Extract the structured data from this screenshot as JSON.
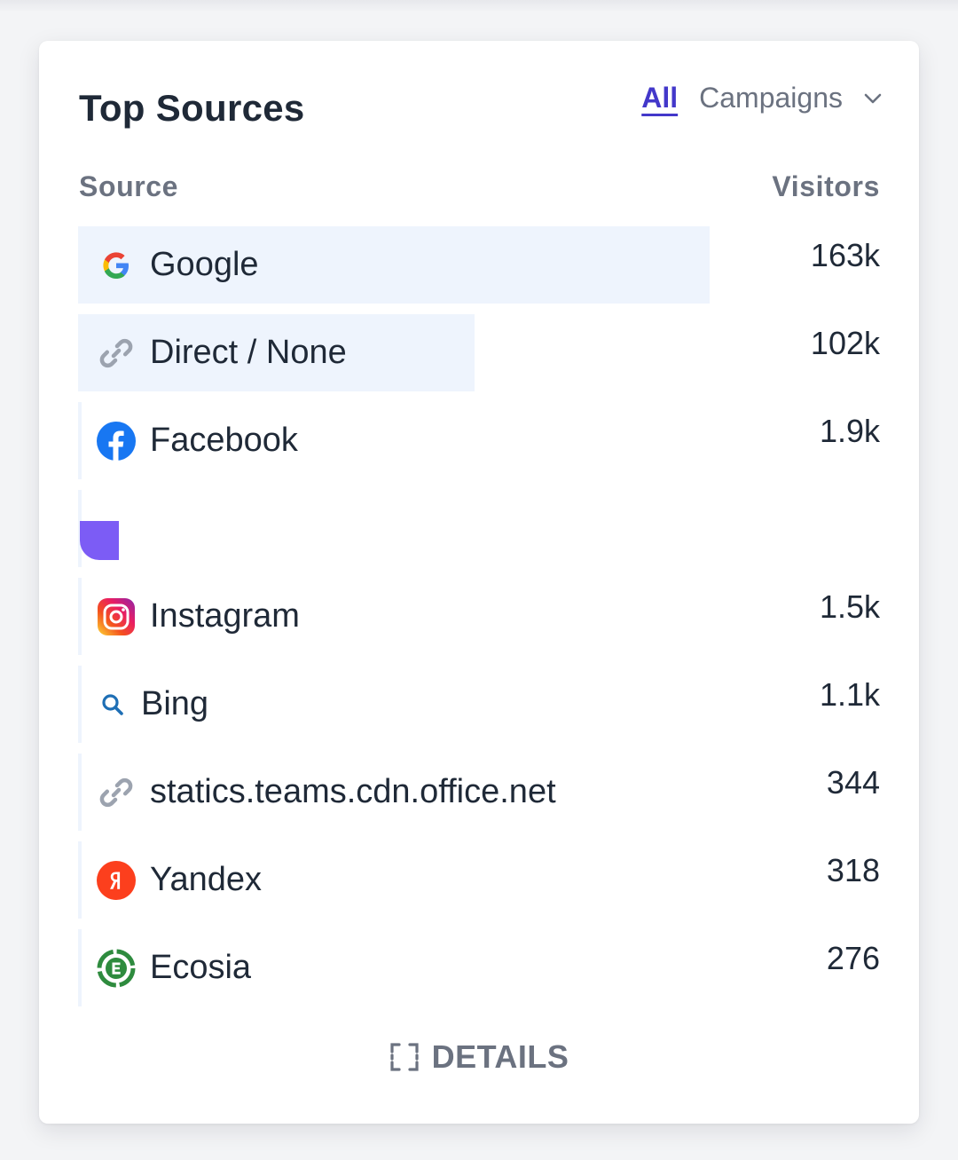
{
  "card": {
    "title": "Top Sources",
    "tabs": [
      {
        "label": "All",
        "active": true
      },
      {
        "label": "Campaigns",
        "active": false
      }
    ]
  },
  "columns": {
    "source": "Source",
    "visitors": "Visitors"
  },
  "colors": {
    "accent": "#4338ca",
    "bar": "#eef4fd",
    "muted": "#6b7280",
    "placeholder_icon": "#7c5cf5"
  },
  "sources": [
    {
      "label": "Google",
      "value": "163k",
      "icon": "google-icon",
      "bar_fraction": 0.788
    },
    {
      "label": "Direct / None",
      "value": "102k",
      "icon": "link-icon",
      "bar_fraction": 0.494
    },
    {
      "label": "Facebook",
      "value": "1.9k",
      "icon": "facebook-icon",
      "bar_fraction": 0.004
    },
    {
      "label": "",
      "value": "",
      "icon": "placeholder-icon",
      "bar_fraction": 0.004
    },
    {
      "label": "Instagram",
      "value": "1.5k",
      "icon": "instagram-icon",
      "bar_fraction": 0.004
    },
    {
      "label": "Bing",
      "value": "1.1k",
      "icon": "search-icon",
      "bar_fraction": 0.004
    },
    {
      "label": "statics.teams.cdn.office.net",
      "value": "344",
      "icon": "link-icon",
      "bar_fraction": 0.002
    },
    {
      "label": "Yandex",
      "value": "318",
      "icon": "yandex-icon",
      "bar_fraction": 0.002
    },
    {
      "label": "Ecosia",
      "value": "276",
      "icon": "ecosia-icon",
      "bar_fraction": 0.002
    }
  ],
  "footer": {
    "details_label": "DETAILS"
  }
}
